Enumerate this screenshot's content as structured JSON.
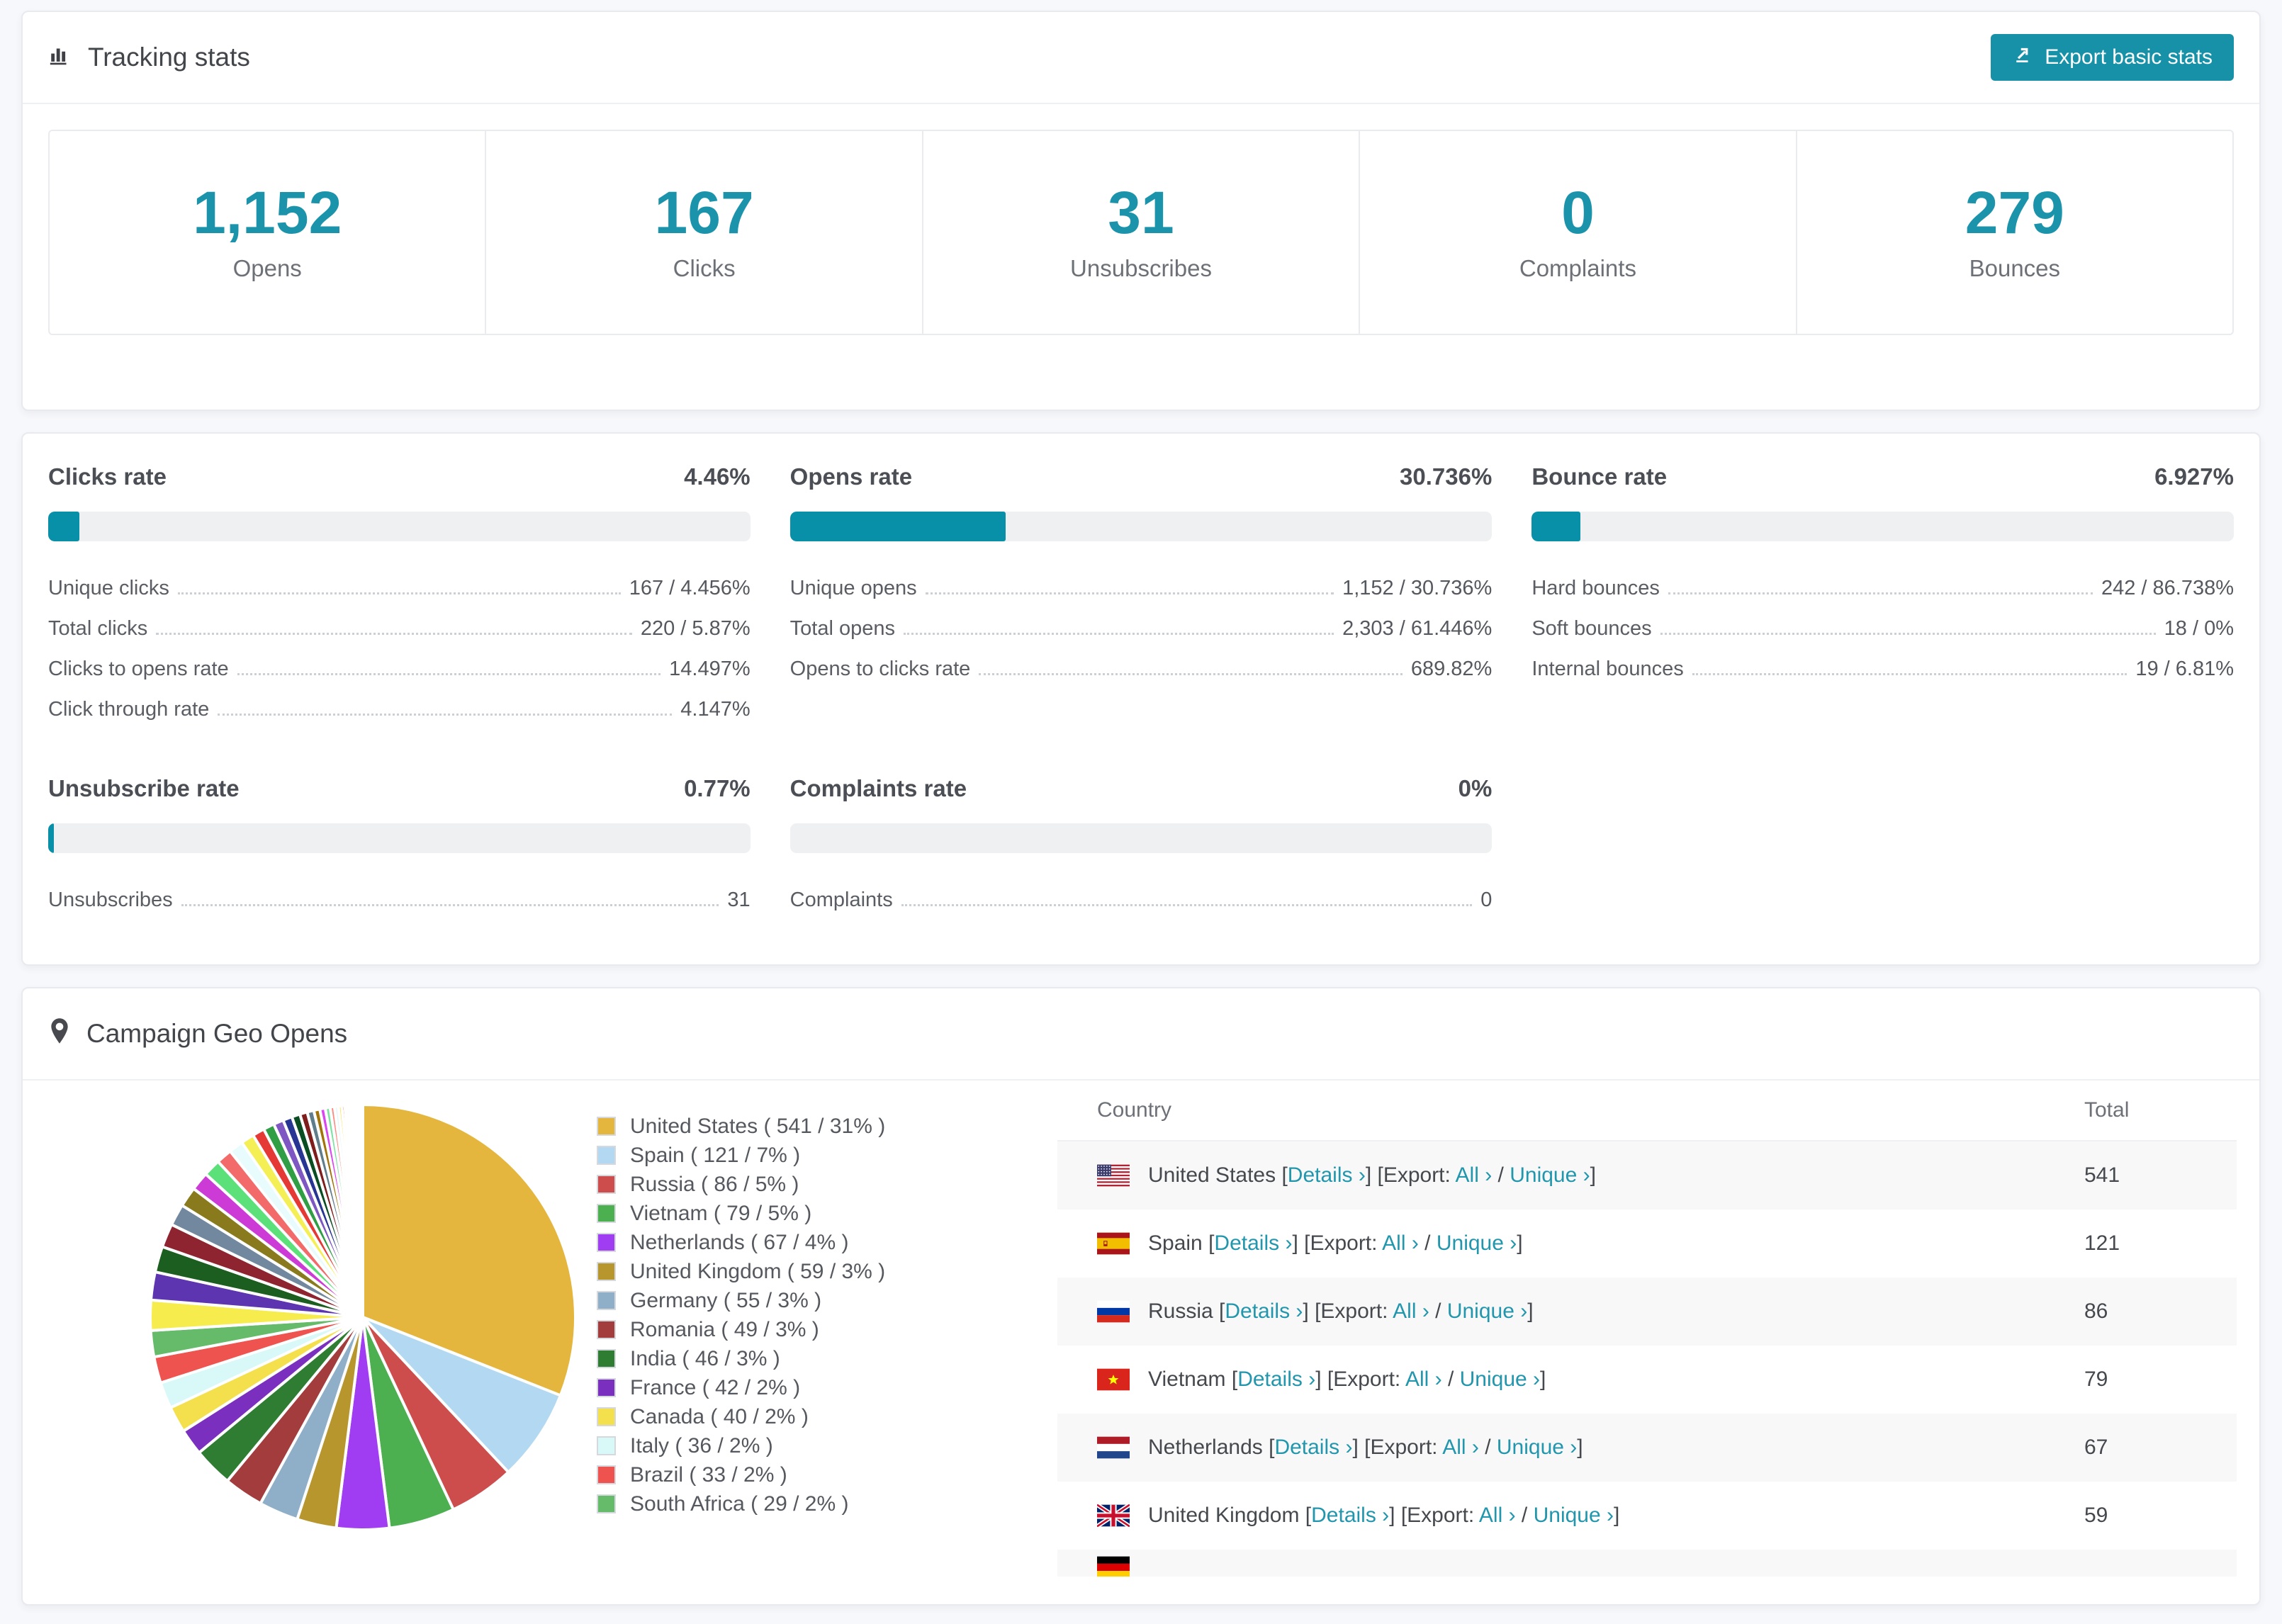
{
  "colors": {
    "accent_teal": "#0890a8",
    "stat_number_teal": "#1b93ab",
    "button_teal": "#1691a8",
    "link_teal": "#2196ac",
    "bar_track": "#eef0f2",
    "row_alt_bg": "#f8f8f9"
  },
  "tracking": {
    "title": "Tracking stats",
    "export_button": "Export basic stats",
    "stats": [
      {
        "value": "1,152",
        "label": "Opens"
      },
      {
        "value": "167",
        "label": "Clicks"
      },
      {
        "value": "31",
        "label": "Unsubscribes"
      },
      {
        "value": "0",
        "label": "Complaints"
      },
      {
        "value": "279",
        "label": "Bounces"
      }
    ]
  },
  "rates": {
    "sections": [
      {
        "title": "Clicks rate",
        "value": "4.46%",
        "percent": 4.46,
        "rows": [
          {
            "label": "Unique clicks",
            "value": "167 / 4.456%"
          },
          {
            "label": "Total clicks",
            "value": "220 / 5.87%"
          },
          {
            "label": "Clicks to opens rate",
            "value": "14.497%"
          },
          {
            "label": "Click through rate",
            "value": "4.147%"
          }
        ]
      },
      {
        "title": "Opens rate",
        "value": "30.736%",
        "percent": 30.736,
        "rows": [
          {
            "label": "Unique opens",
            "value": "1,152 / 30.736%"
          },
          {
            "label": "Total opens",
            "value": "2,303 / 61.446%"
          },
          {
            "label": "Opens to clicks rate",
            "value": "689.82%"
          }
        ]
      },
      {
        "title": "Bounce rate",
        "value": "6.927%",
        "percent": 6.927,
        "rows": [
          {
            "label": "Hard bounces",
            "value": "242 / 86.738%"
          },
          {
            "label": "Soft bounces",
            "value": "18 / 0%"
          },
          {
            "label": "Internal bounces",
            "value": "19 / 6.81%"
          }
        ]
      },
      {
        "title": "Unsubscribe rate",
        "value": "0.77%",
        "percent": 0.77,
        "rows": [
          {
            "label": "Unsubscribes",
            "value": "31"
          }
        ]
      },
      {
        "title": "Complaints rate",
        "value": "0%",
        "percent": 0,
        "rows": [
          {
            "label": "Complaints",
            "value": "0"
          }
        ]
      }
    ]
  },
  "geo": {
    "title": "Campaign Geo Opens",
    "legend_labels": [
      "United States ( 541 / 31% )",
      "Spain ( 121 / 7% )",
      "Russia ( 86 / 5% )",
      "Vietnam ( 79 / 5% )",
      "Netherlands ( 67 / 4% )",
      "United Kingdom ( 59 / 3% )",
      "Germany ( 55 / 3% )",
      "Romania ( 49 / 3% )",
      "India ( 46 / 3% )",
      "France ( 42 / 2% )",
      "Canada ( 40 / 2% )",
      "Italy ( 36 / 2% )",
      "Brazil ( 33 / 2% )",
      "South Africa ( 29 / 2% )"
    ],
    "table": {
      "headers": [
        "Country",
        "Total"
      ],
      "links": {
        "details": "Details ›",
        "export_label": "Export:",
        "all": "All ›",
        "sep": "/",
        "unique": "Unique ›"
      },
      "rows": [
        {
          "flag": "us",
          "country": "United States",
          "total": "541"
        },
        {
          "flag": "es",
          "country": "Spain",
          "total": "121"
        },
        {
          "flag": "ru",
          "country": "Russia",
          "total": "86"
        },
        {
          "flag": "vn",
          "country": "Vietnam",
          "total": "79"
        },
        {
          "flag": "nl",
          "country": "Netherlands",
          "total": "67"
        },
        {
          "flag": "gb",
          "country": "United Kingdom",
          "total": "59"
        }
      ],
      "partial_row": {
        "flag": "de"
      }
    }
  },
  "chart_data": {
    "type": "pie",
    "title": "Campaign Geo Opens",
    "legend_position": "right",
    "series": [
      {
        "name": "United States",
        "count": 541,
        "pct": 31,
        "color": "#e4b63d"
      },
      {
        "name": "Spain",
        "count": 121,
        "pct": 7,
        "color": "#b3d9f2"
      },
      {
        "name": "Russia",
        "count": 86,
        "pct": 5,
        "color": "#cd4c4c"
      },
      {
        "name": "Vietnam",
        "count": 79,
        "pct": 5,
        "color": "#4caf50"
      },
      {
        "name": "Netherlands",
        "count": 67,
        "pct": 4,
        "color": "#a03df2"
      },
      {
        "name": "United Kingdom",
        "count": 59,
        "pct": 3,
        "color": "#b8962e"
      },
      {
        "name": "Germany",
        "count": 55,
        "pct": 3,
        "color": "#8fafc8"
      },
      {
        "name": "Romania",
        "count": 49,
        "pct": 3,
        "color": "#a33c3c"
      },
      {
        "name": "India",
        "count": 46,
        "pct": 3,
        "color": "#2e7d32"
      },
      {
        "name": "France",
        "count": 42,
        "pct": 2,
        "color": "#7b2fbe"
      },
      {
        "name": "Canada",
        "count": 40,
        "pct": 2,
        "color": "#f4e04d"
      },
      {
        "name": "Italy",
        "count": 36,
        "pct": 2,
        "color": "#d9f8f8"
      },
      {
        "name": "Brazil",
        "count": 33,
        "pct": 2,
        "color": "#ef5350"
      },
      {
        "name": "South Africa",
        "count": 29,
        "pct": 2,
        "color": "#66bb6a"
      }
    ],
    "others_unlabeled_tail": {
      "pct_total": 26,
      "weights": [
        2.1,
        1.95,
        1.8,
        1.65,
        1.5,
        1.4,
        1.3,
        1.2,
        1.1,
        1.0,
        0.92,
        0.84,
        0.77,
        0.7,
        0.64,
        0.58,
        0.52,
        0.47,
        0.42,
        0.38,
        0.34,
        0.3,
        0.27,
        0.24,
        0.21,
        0.18,
        0.16,
        0.14,
        0.12,
        0.1,
        0.09,
        0.08,
        0.07,
        0.06,
        0.05,
        0.05,
        0.04,
        0.04,
        0.03,
        0.03
      ],
      "colors": [
        "#f6ec4e",
        "#5e35b1",
        "#1b5e20",
        "#8e2430",
        "#71889e",
        "#8a7a1e",
        "#cd3bd6",
        "#5be07a",
        "#f26a6a",
        "#e8fbfd",
        "#f4ef55",
        "#e53935",
        "#2f9e44",
        "#7e57c2",
        "#283593",
        "#0b4d22",
        "#7f1d1d",
        "#607d8b",
        "#a1720a",
        "#d946ef",
        "#7ce2a0",
        "#ff8a80",
        "#e0f7fa",
        "#fde047",
        "#d32f2f",
        "#16a34a",
        "#9333ea",
        "#1e3a8a",
        "#145a32",
        "#991b1b",
        "#90a4ae",
        "#c9a227",
        "#e879f9",
        "#a5f3c7",
        "#ffcdd2",
        "#ccf7fb",
        "#f7d84a",
        "#b91c1c",
        "#39d353",
        "#b26ef7"
      ]
    }
  }
}
